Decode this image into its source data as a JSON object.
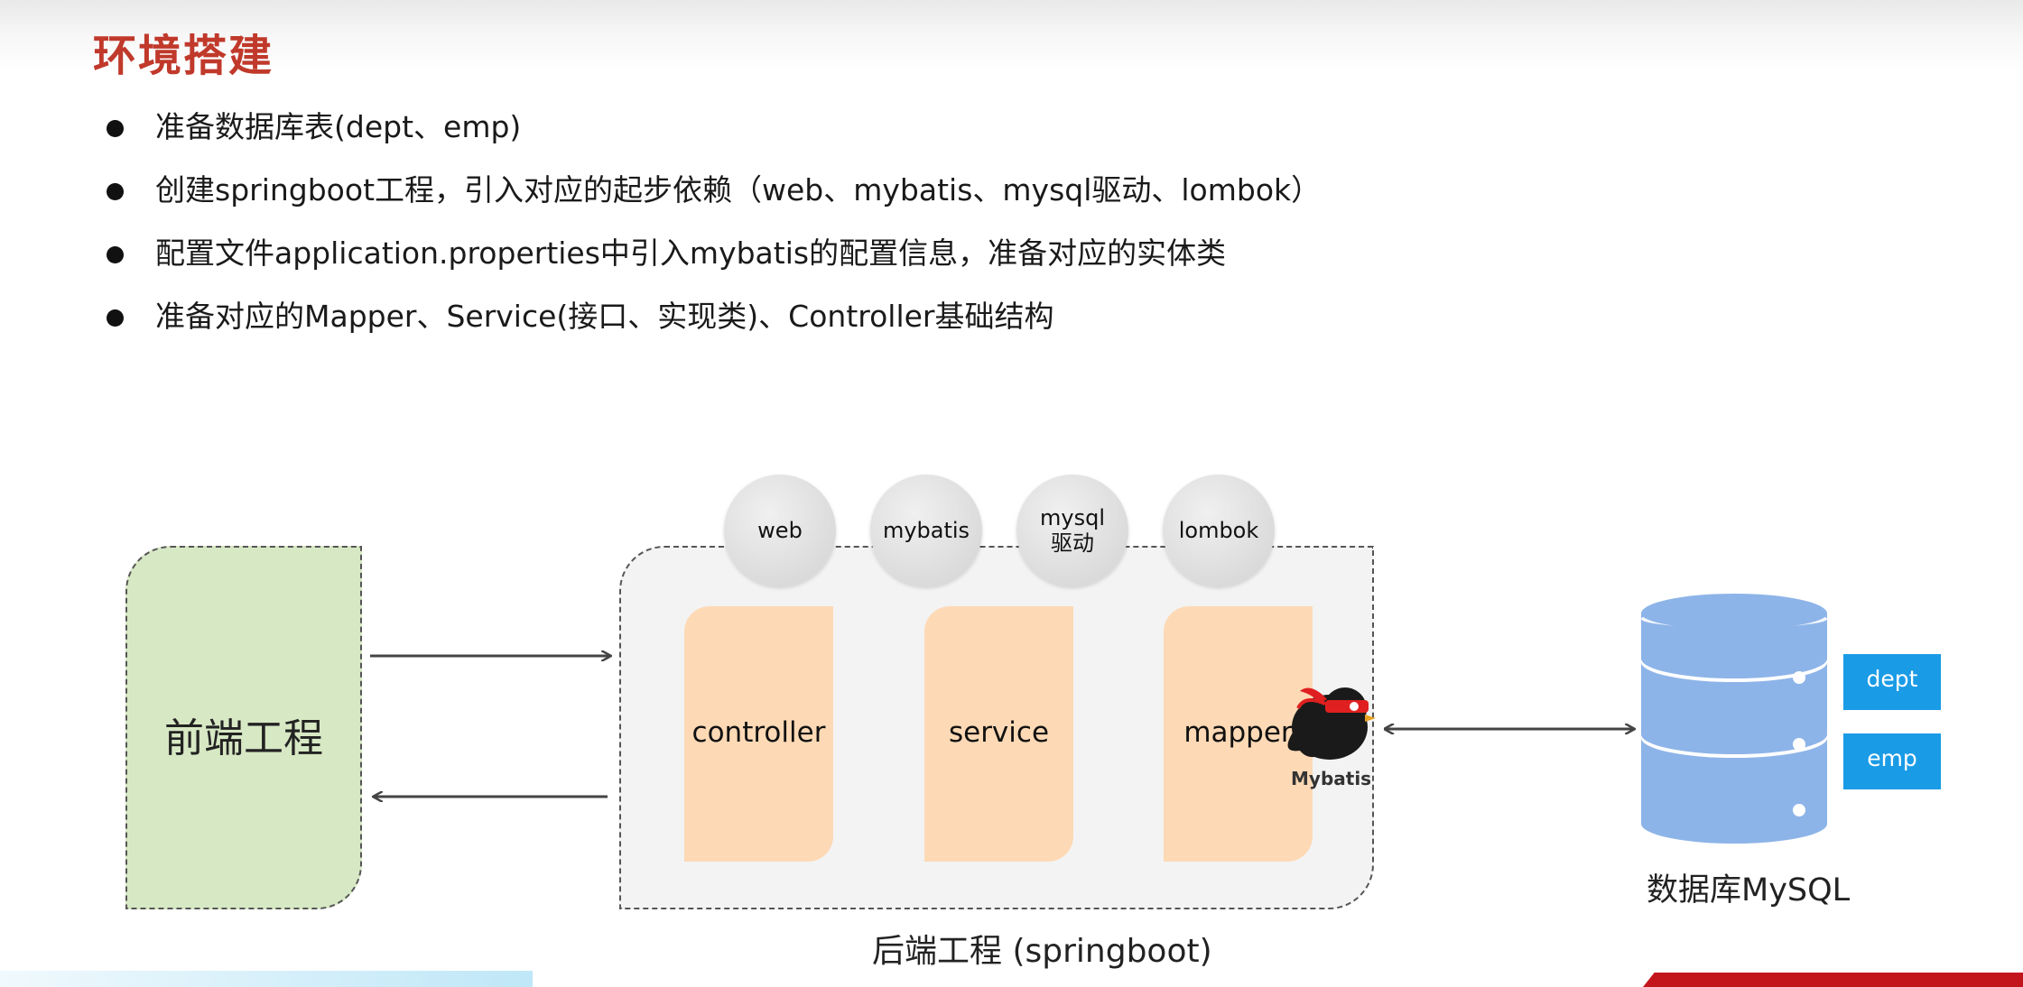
{
  "slide": {
    "title": "环境搭建",
    "bullets": [
      "准备数据库表(dept、emp)",
      "创建springboot工程，引入对应的起步依赖（web、mybatis、mysql驱动、lombok）",
      "配置文件application.properties中引入mybatis的配置信息，准备对应的实体类",
      "准备对应的Mapper、Service(接口、实现类)、Controller基础结构"
    ]
  },
  "diagram": {
    "frontend_label": "前端工程",
    "backend_label": "后端工程 (springboot)",
    "dependencies": [
      "web",
      "mybatis",
      "mysql\n驱动",
      "lombok"
    ],
    "layers": [
      "controller",
      "service",
      "mapper"
    ],
    "mybatis_logo_text": "Mybatis",
    "database_label": "数据库MySQL",
    "tables": [
      "dept",
      "emp"
    ]
  },
  "colors": {
    "title": "#c0392b",
    "frontend_fill": "#d7e8c4",
    "layer_fill": "#fdd9b5",
    "db_blue": "#8db4e8",
    "table_tag": "#1a9be6"
  }
}
